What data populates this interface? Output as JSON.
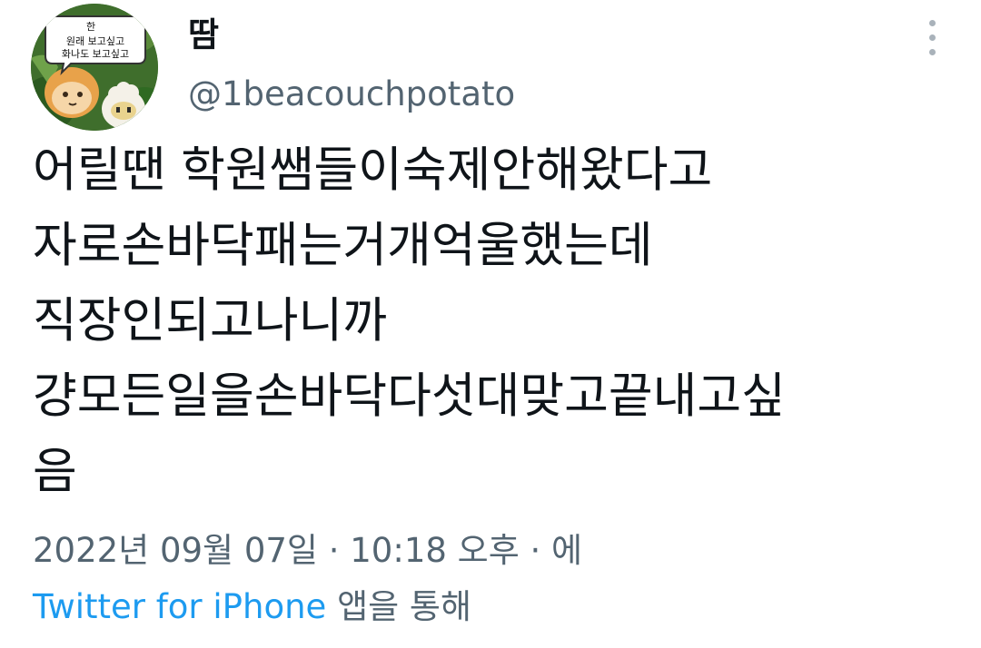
{
  "author": {
    "display_name": "땀",
    "handle": "@1beacouchpotato",
    "avatar_bubble": [
      "한",
      "원래 보고싶고",
      "화나도 보고싶고"
    ]
  },
  "tweet": {
    "lines": [
      "어릴땐 학원쌤들이숙제안해왔다고",
      "자로손바닥패는거개억울했는데",
      "직장인되고나니까",
      "걍모든일을손바닥다섯대맞고끝내고싶",
      "음"
    ]
  },
  "meta": {
    "date": "2022년 09월 07일",
    "separator": "·",
    "time": "10:18 오후",
    "trailing": "에"
  },
  "source": {
    "link": "Twitter for iPhone",
    "suffix": " 앱을 통해"
  },
  "colors": {
    "text": "#0f1419",
    "secondary": "#536471",
    "link": "#1d9bf0"
  },
  "icons": {
    "more": "more-vertical-icon"
  }
}
